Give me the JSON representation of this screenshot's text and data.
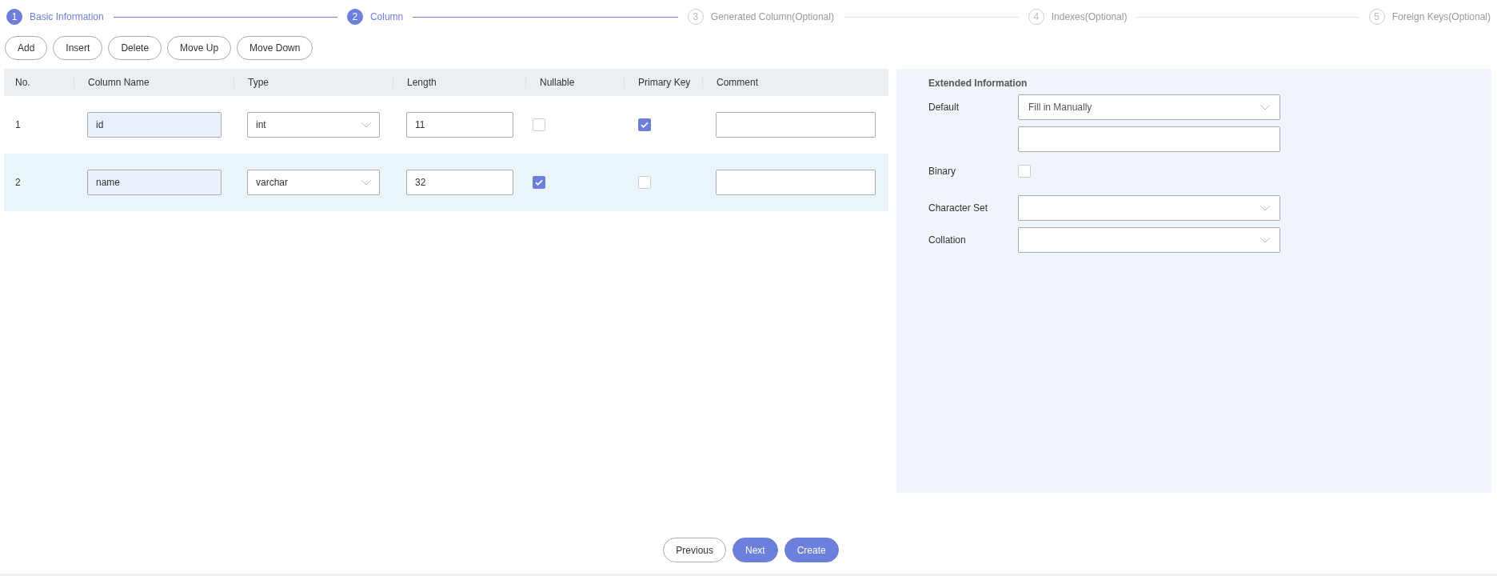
{
  "steps": [
    {
      "number": "1",
      "label": "Basic Information",
      "kind": "finished"
    },
    {
      "number": "2",
      "label": "Column",
      "kind": "current"
    },
    {
      "number": "3",
      "label": "Generated Column(Optional)",
      "kind": "pending"
    },
    {
      "number": "4",
      "label": "Indexes(Optional)",
      "kind": "pending"
    },
    {
      "number": "5",
      "label": "Foreign Keys(Optional)",
      "kind": "pending"
    }
  ],
  "toolbar": [
    "Add",
    "Insert",
    "Delete",
    "Move Up",
    "Move Down"
  ],
  "table": {
    "columns": [
      "No.",
      "Column Name",
      "Type",
      "Length",
      "Nullable",
      "Primary Key",
      "Comment"
    ],
    "rows": [
      {
        "no": "1",
        "column_name": "id",
        "type": "int",
        "length": "11",
        "nullable": false,
        "primary_key": true,
        "selected": false
      },
      {
        "no": "2",
        "column_name": "name",
        "type": "varchar",
        "length": "32",
        "nullable": true,
        "primary_key": false,
        "selected": true
      }
    ]
  },
  "extended_information": {
    "title": "Extended Information",
    "fields": [
      {
        "kind": "select",
        "label": "Default",
        "value": "Fill in Manually"
      },
      {
        "kind": "input"
      },
      {
        "kind": "checkbox",
        "label": "Binary",
        "checked": false
      },
      {
        "kind": "select",
        "label": "Character Set"
      },
      {
        "kind": "select",
        "label": "Collation"
      }
    ]
  },
  "footer": [
    {
      "label": "Previous",
      "primary": false
    },
    {
      "label": "Next",
      "primary": true
    },
    {
      "label": "Create",
      "primary": true
    }
  ]
}
